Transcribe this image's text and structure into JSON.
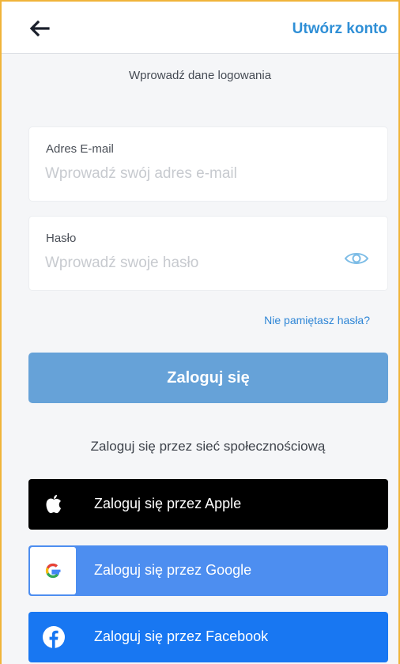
{
  "header": {
    "back_icon": "arrow-left-icon",
    "create_account_label": "Utwórz konto"
  },
  "subtitle": "Wprowadź dane logowania",
  "email_field": {
    "label": "Adres E-mail",
    "placeholder": "Wprowadź swój adres e-mail",
    "value": ""
  },
  "password_field": {
    "label": "Hasło",
    "placeholder": "Wprowadź swoje hasło",
    "value": "",
    "toggle_icon": "eye-icon"
  },
  "forgot_password_label": "Nie pamiętasz hasła?",
  "login_button_label": "Zaloguj się",
  "social": {
    "title": "Zaloguj się przez sieć społecznościową",
    "apple_label": "Zaloguj się przez Apple",
    "google_label": "Zaloguj się przez Google",
    "facebook_label": "Zaloguj się przez Facebook"
  },
  "colors": {
    "accent": "#2f8fd6",
    "login_button": "#66a2d8",
    "apple": "#000000",
    "google": "#4d8ef0",
    "facebook": "#1877f2",
    "frame_border": "#f0b43a"
  }
}
